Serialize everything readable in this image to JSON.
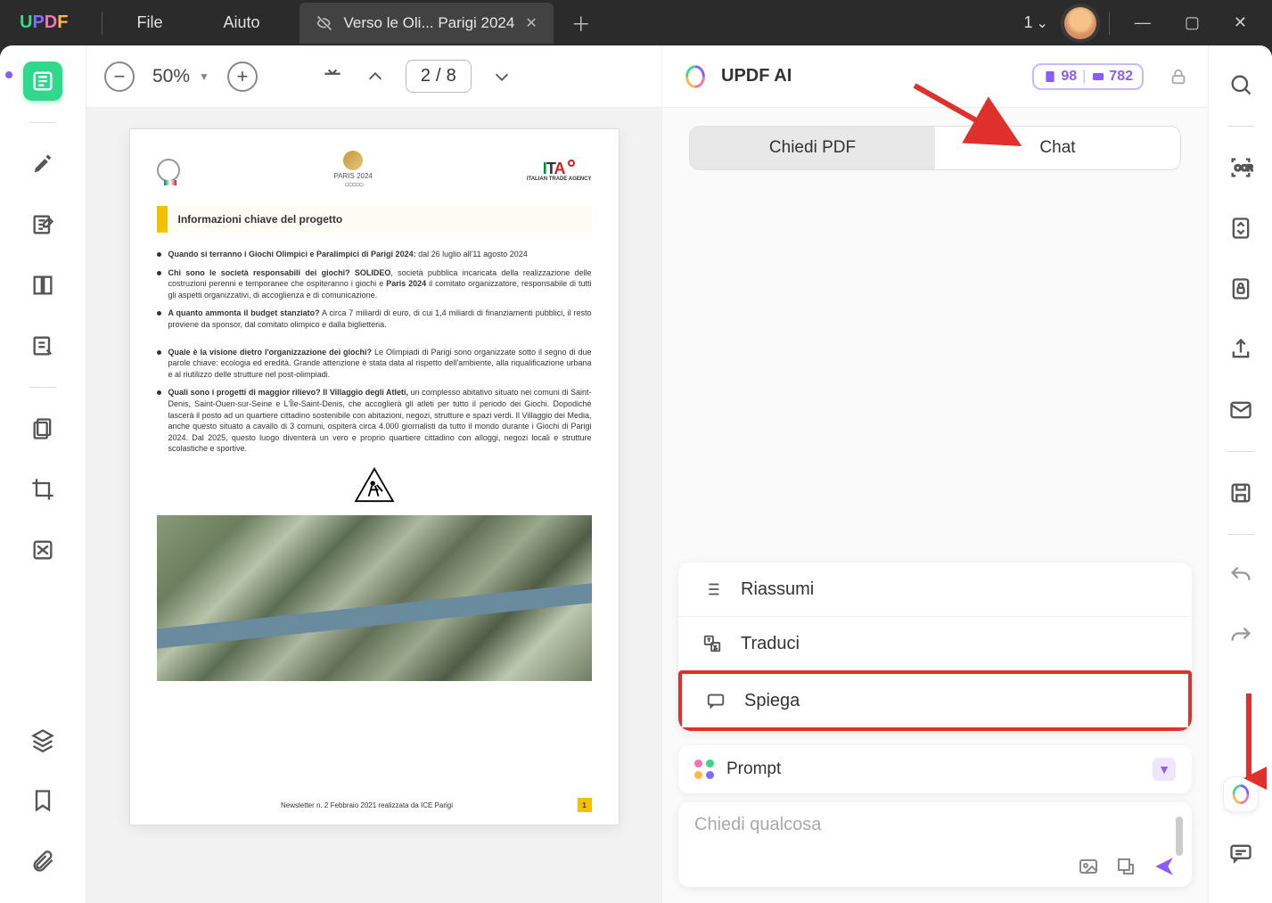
{
  "app": {
    "logo_letters": [
      "U",
      "P",
      "D",
      "F"
    ],
    "menu_file": "File",
    "menu_help": "Aiuto"
  },
  "tab": {
    "title": "Verso le Oli... Parigi 2024"
  },
  "titlebar": {
    "doc_index": "1"
  },
  "toolbar": {
    "zoom": "50%",
    "page_current": "2",
    "page_sep": "/",
    "page_total": "8"
  },
  "doc": {
    "heading": "Informazioni chiave del progetto",
    "bullets": [
      {
        "bold": "Quando si terranno i Giochi Olimpici e Paralimpici di Parigi 2024:",
        "rest": " dal 26 luglio all'11 agosto 2024"
      },
      {
        "bold": "Chi sono le società responsabili dei giochi? SOLIDEO",
        "rest": ", società pubblica incaricata della realizzazione delle costruzioni perenni e temporanee che ospiteranno i giochi e ",
        "bold2": "Paris 2024",
        "rest2": " il comitato organizzatore, responsabile di tutti gli aspetti organizzativi, di accoglienza e di comunicazione."
      },
      {
        "bold": "A quanto ammonta il budget stanziato?",
        "rest": " A circa 7 miliardi di euro, di cui 1,4 miliardi di finanziamenti pubblici, il resto proviene da sponsor, dal comitato olimpico e dalla biglietteria."
      },
      {
        "bold": "Quale è la visione dietro l'organizzazione dei giochi?",
        "rest": " Le Olimpiadi di Parigi sono organizzate sotto il segno di due parole chiave: ecologia ed eredità. Grande attenzione è stata data al rispetto dell'ambiente, alla riqualificazione urbana e al riutilizzo delle strutture nel post-olimpiadi."
      },
      {
        "bold": "Quali sono i progetti di maggior rilievo? Il Villaggio degli Atleti,",
        "rest": " un complesso abitativo situato nei comuni di Saint-Denis, Saint-Ouen-sur-Seine e L'Île-Saint-Denis, che accoglierà gli atleti per tutto il periodo dei Giochi. Dopodiché lascerà il posto ad un quartiere cittadino sostenibile con abitazioni, negozi, strutture e spazi verdi. Il Villaggio dei Media, anche questo situato a cavallo di 3 comuni, ospiterà circa 4.000 giornalisti da tutto il mondo durante i Giochi di Parigi 2024. Dal 2025, questo luogo diventerà un vero e proprio quartiere cittadino con alloggi, negozi locali e strutture scolastiche e sportive."
      }
    ],
    "paris_label": "PARIS 2024",
    "ita_sub": "ITALIAN TRADE AGENCY",
    "footer_text": "Newsletter n. 2 Febbraio 2021 realizzata da ICE Parigi",
    "page_number": "1"
  },
  "ai": {
    "title": "UPDF AI",
    "badge_pages": "98",
    "badge_credits": "782",
    "tab_pdf": "Chiedi PDF",
    "tab_chat": "Chat",
    "actions": {
      "summarize": "Riassumi",
      "translate": "Traduci",
      "explain": "Spiega"
    },
    "prompt_label": "Prompt",
    "input_placeholder": "Chiedi qualcosa"
  }
}
